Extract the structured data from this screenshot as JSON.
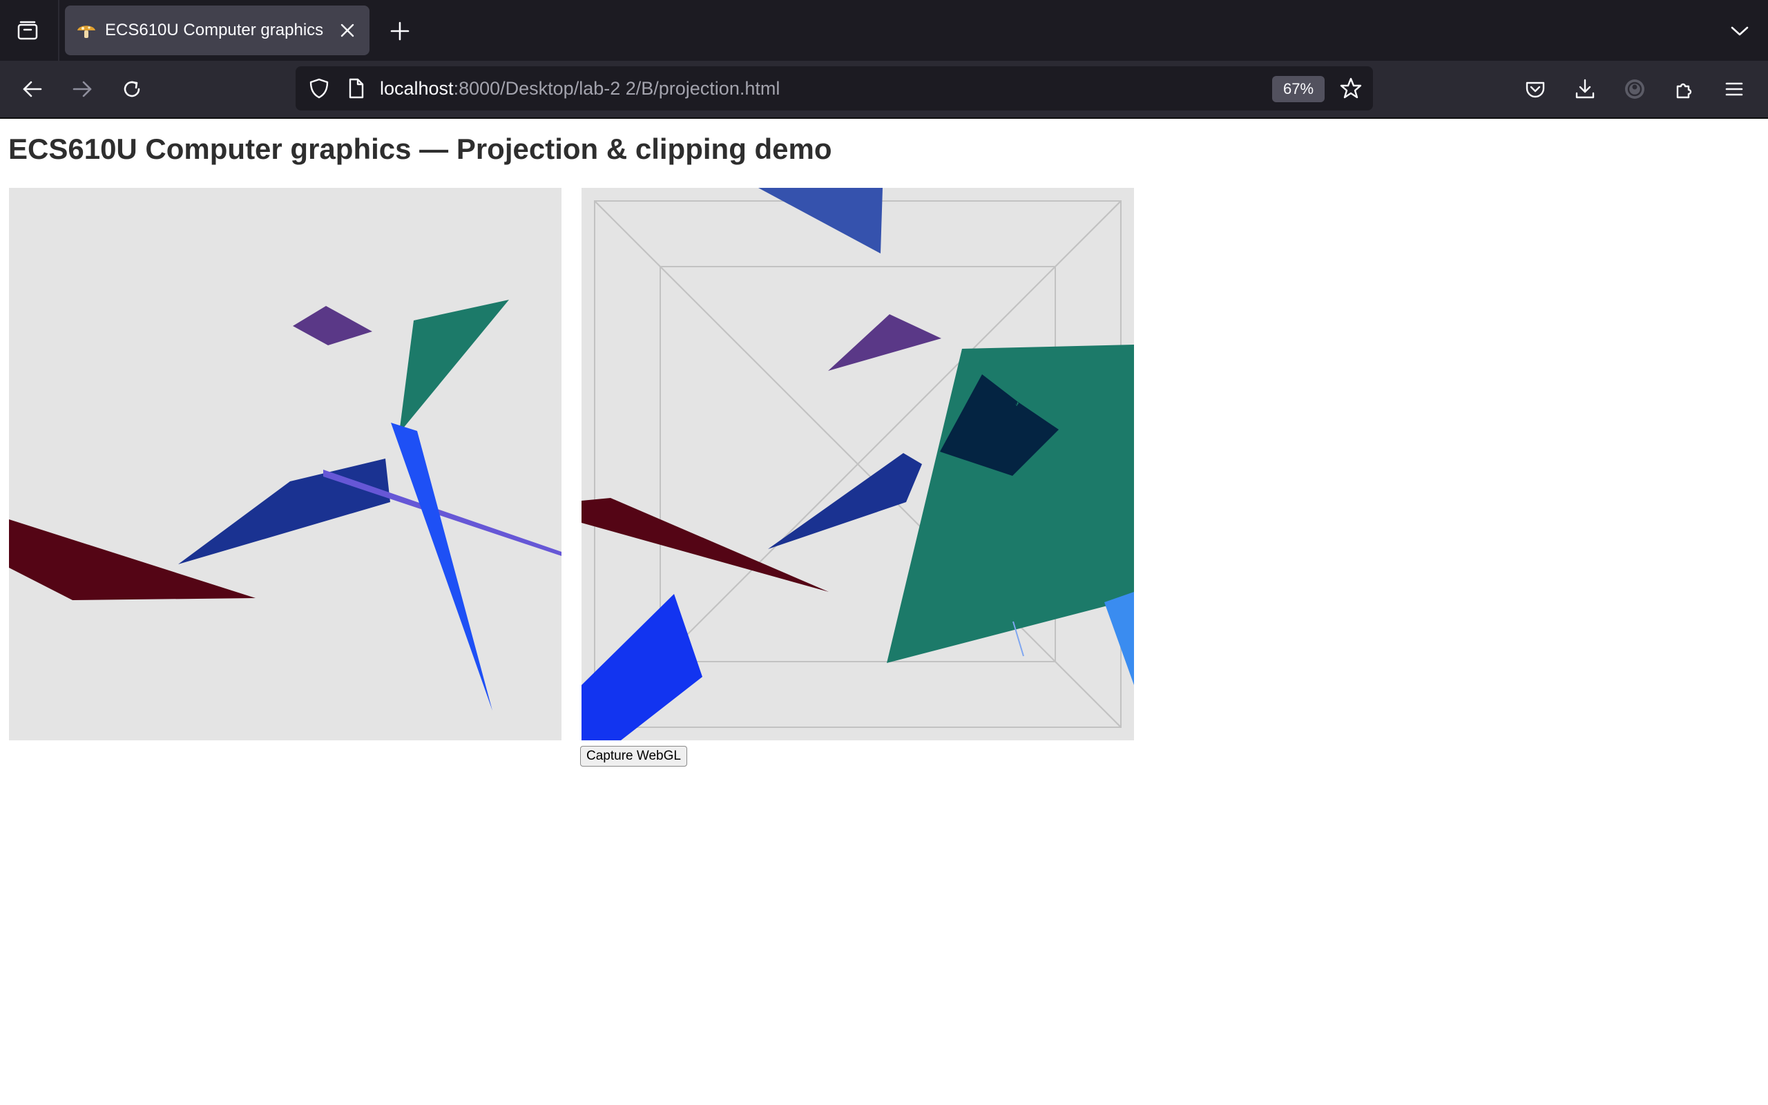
{
  "browser": {
    "tab": {
      "title": "ECS610U Computer graphics",
      "favicon": "mushroom-icon"
    },
    "url": {
      "host": "localhost",
      "rest": ":8000/Desktop/lab-2 2/B/projection.html"
    },
    "zoom": "67%",
    "icons": [
      "tab-list-icon",
      "close-icon",
      "plus-icon",
      "chevron-down-icon",
      "back-arrow-icon",
      "forward-arrow-icon",
      "reload-icon",
      "shield-icon",
      "page-icon",
      "star-icon",
      "pocket-icon",
      "download-icon",
      "account-icon",
      "extensions-icon",
      "menu-icon"
    ],
    "colors": {
      "tabbar": "#1c1b22",
      "navbar": "#2b2a33",
      "urlbar": "#1c1b22",
      "active_tab": "#42414d"
    }
  },
  "page": {
    "heading": "ECS610U Computer graphics — Projection & clipping demo",
    "capture_button": "Capture WebGL",
    "canvas_background": "#e4e4e4",
    "shape_colors": {
      "purple": "#5a3887",
      "green": "#1c7a69",
      "dark_blue": "#1a3291",
      "bright_blue": "#1e50f5",
      "violet": "#6657d6",
      "maroon": "#540515",
      "mid_blue": "#3552ad",
      "navy": "#042442",
      "vivid_blue": "#1234f0",
      "sky_blue": "#3a8cf0",
      "frustum_lines": "#c2c2c2"
    }
  }
}
